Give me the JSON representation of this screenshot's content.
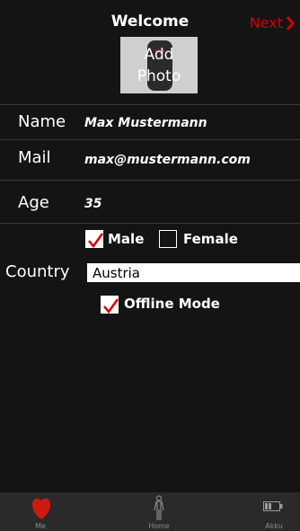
{
  "header": {
    "title": "Welcome",
    "next_label": "Next"
  },
  "photo": {
    "label": "Add Photo"
  },
  "fields": [
    {
      "label": "Name",
      "value": "Max Mustermann"
    },
    {
      "label": "Mail",
      "value": "max@mustermann.com"
    },
    {
      "label": "Age",
      "value": "35"
    }
  ],
  "gender": {
    "male_label": "Male",
    "male_checked": true,
    "female_label": "Female",
    "female_checked": false
  },
  "country": {
    "label": "Country",
    "value": "Austria"
  },
  "offline": {
    "label": "Offline Mode",
    "checked": true
  },
  "tabs": [
    {
      "label": "Me",
      "icon": "heart-icon"
    },
    {
      "label": "Home",
      "icon": "body-icon"
    },
    {
      "label": "Akku",
      "icon": "battery-icon"
    }
  ],
  "colors": {
    "accent": "#d40000",
    "background": "#141414",
    "tabbar": "#2a2a2a"
  }
}
